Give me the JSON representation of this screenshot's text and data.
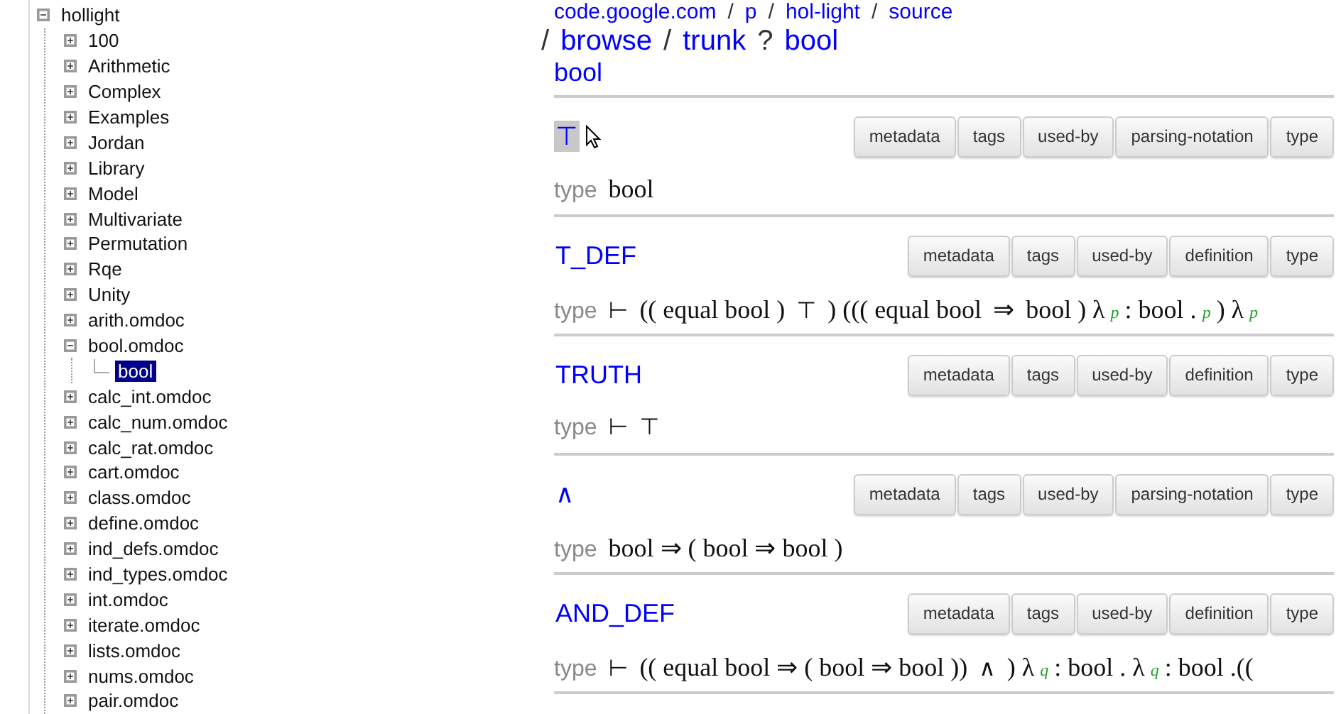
{
  "tree": {
    "label": "hollight",
    "expanded": true,
    "selected": false,
    "children": [
      {
        "label": "100",
        "expanded": false,
        "selected": false
      },
      {
        "label": "Arithmetic",
        "expanded": false,
        "selected": false
      },
      {
        "label": "Complex",
        "expanded": false,
        "selected": false
      },
      {
        "label": "Examples",
        "expanded": false,
        "selected": false
      },
      {
        "label": "Jordan",
        "expanded": false,
        "selected": false
      },
      {
        "label": "Library",
        "expanded": false,
        "selected": false
      },
      {
        "label": "Model",
        "expanded": false,
        "selected": false
      },
      {
        "label": "Multivariate",
        "expanded": false,
        "selected": false
      },
      {
        "label": "Permutation",
        "expanded": false,
        "selected": false
      },
      {
        "label": "Rqe",
        "expanded": false,
        "selected": false
      },
      {
        "label": "Unity",
        "expanded": false,
        "selected": false
      },
      {
        "label": "arith.omdoc",
        "expanded": false,
        "selected": false
      },
      {
        "label": "bool.omdoc",
        "expanded": true,
        "selected": false,
        "children": [
          {
            "label": "bool",
            "selected": true
          }
        ]
      },
      {
        "label": "calc_int.omdoc",
        "expanded": false,
        "selected": false
      },
      {
        "label": "calc_num.omdoc",
        "expanded": false,
        "selected": false
      },
      {
        "label": "calc_rat.omdoc",
        "expanded": false,
        "selected": false
      },
      {
        "label": "cart.omdoc",
        "expanded": false,
        "selected": false
      },
      {
        "label": "class.omdoc",
        "expanded": false,
        "selected": false
      },
      {
        "label": "define.omdoc",
        "expanded": false,
        "selected": false
      },
      {
        "label": "ind_defs.omdoc",
        "expanded": false,
        "selected": false
      },
      {
        "label": "ind_types.omdoc",
        "expanded": false,
        "selected": false
      },
      {
        "label": "int.omdoc",
        "expanded": false,
        "selected": false
      },
      {
        "label": "iterate.omdoc",
        "expanded": false,
        "selected": false
      },
      {
        "label": "lists.omdoc",
        "expanded": false,
        "selected": false
      },
      {
        "label": "nums.omdoc",
        "expanded": false,
        "selected": false
      },
      {
        "label": "pair.omdoc",
        "expanded": false,
        "selected": false
      }
    ]
  },
  "breadcrumb": [
    [
      {
        "kind": "link",
        "text": "code.google.com"
      },
      {
        "kind": "sep",
        "text": "/"
      },
      {
        "kind": "link",
        "text": "p"
      },
      {
        "kind": "sep",
        "text": "/"
      },
      {
        "kind": "link",
        "text": "hol-light"
      },
      {
        "kind": "sep",
        "text": "/"
      },
      {
        "kind": "link",
        "text": "source"
      }
    ],
    [
      {
        "kind": "sep",
        "text": "/"
      },
      {
        "kind": "link",
        "text": "browse"
      },
      {
        "kind": "sep",
        "text": "/"
      },
      {
        "kind": "link",
        "text": "trunk"
      },
      {
        "kind": "sep",
        "text": "?"
      },
      {
        "kind": "link",
        "text": "bool"
      }
    ]
  ],
  "theory_title": "bool",
  "declarations": [
    {
      "name": "⊤",
      "highlighted": true,
      "buttons": [
        "metadata",
        "tags",
        "used-by",
        "parsing-notation",
        "type"
      ],
      "type_label": "type",
      "type": [
        {
          "kind": "term",
          "text": "bool"
        }
      ]
    },
    {
      "name": "T_DEF",
      "highlighted": false,
      "buttons": [
        "metadata",
        "tags",
        "used-by",
        "definition",
        "type"
      ],
      "type_label": "type",
      "type": [
        {
          "kind": "sym",
          "text": "⊢"
        },
        {
          "kind": "term",
          "text": "(( equal  bool )"
        },
        {
          "kind": "sym",
          "text": "⊤"
        },
        {
          "kind": "term",
          "text": ")  ((( equal  bool"
        },
        {
          "kind": "term",
          "text": "⇒"
        },
        {
          "kind": "term",
          "text": "bool )  λ"
        },
        {
          "kind": "var",
          "text": "p"
        },
        {
          "kind": "term",
          "text": ": bool ."
        },
        {
          "kind": "var",
          "text": "p"
        },
        {
          "kind": "term",
          "text": ")  λ"
        },
        {
          "kind": "var",
          "text": "p"
        }
      ]
    },
    {
      "name": "TRUTH",
      "highlighted": false,
      "buttons": [
        "metadata",
        "tags",
        "used-by",
        "definition",
        "type"
      ],
      "type_label": "type",
      "type": [
        {
          "kind": "sym",
          "text": "⊢"
        },
        {
          "kind": "sym",
          "text": "⊤"
        }
      ]
    },
    {
      "name": "∧",
      "highlighted": false,
      "buttons": [
        "metadata",
        "tags",
        "used-by",
        "parsing-notation",
        "type"
      ],
      "type_label": "type",
      "type": [
        {
          "kind": "term",
          "text": "bool  ⇒ ( bool  ⇒  bool )"
        }
      ]
    },
    {
      "name": "AND_DEF",
      "highlighted": false,
      "buttons": [
        "metadata",
        "tags",
        "used-by",
        "definition",
        "type"
      ],
      "type_label": "type",
      "type": [
        {
          "kind": "sym",
          "text": "⊢"
        },
        {
          "kind": "term",
          "text": "(( equal  bool  ⇒ ( bool  ⇒  bool ))"
        },
        {
          "kind": "sym",
          "text": "∧"
        },
        {
          "kind": "term",
          "text": ")  λ"
        },
        {
          "kind": "var",
          "text": "q"
        },
        {
          "kind": "term",
          "text": ":  bool  .  λ"
        },
        {
          "kind": "var",
          "text": "q"
        },
        {
          "kind": "term",
          "text": ":  bool  .(("
        }
      ]
    }
  ]
}
